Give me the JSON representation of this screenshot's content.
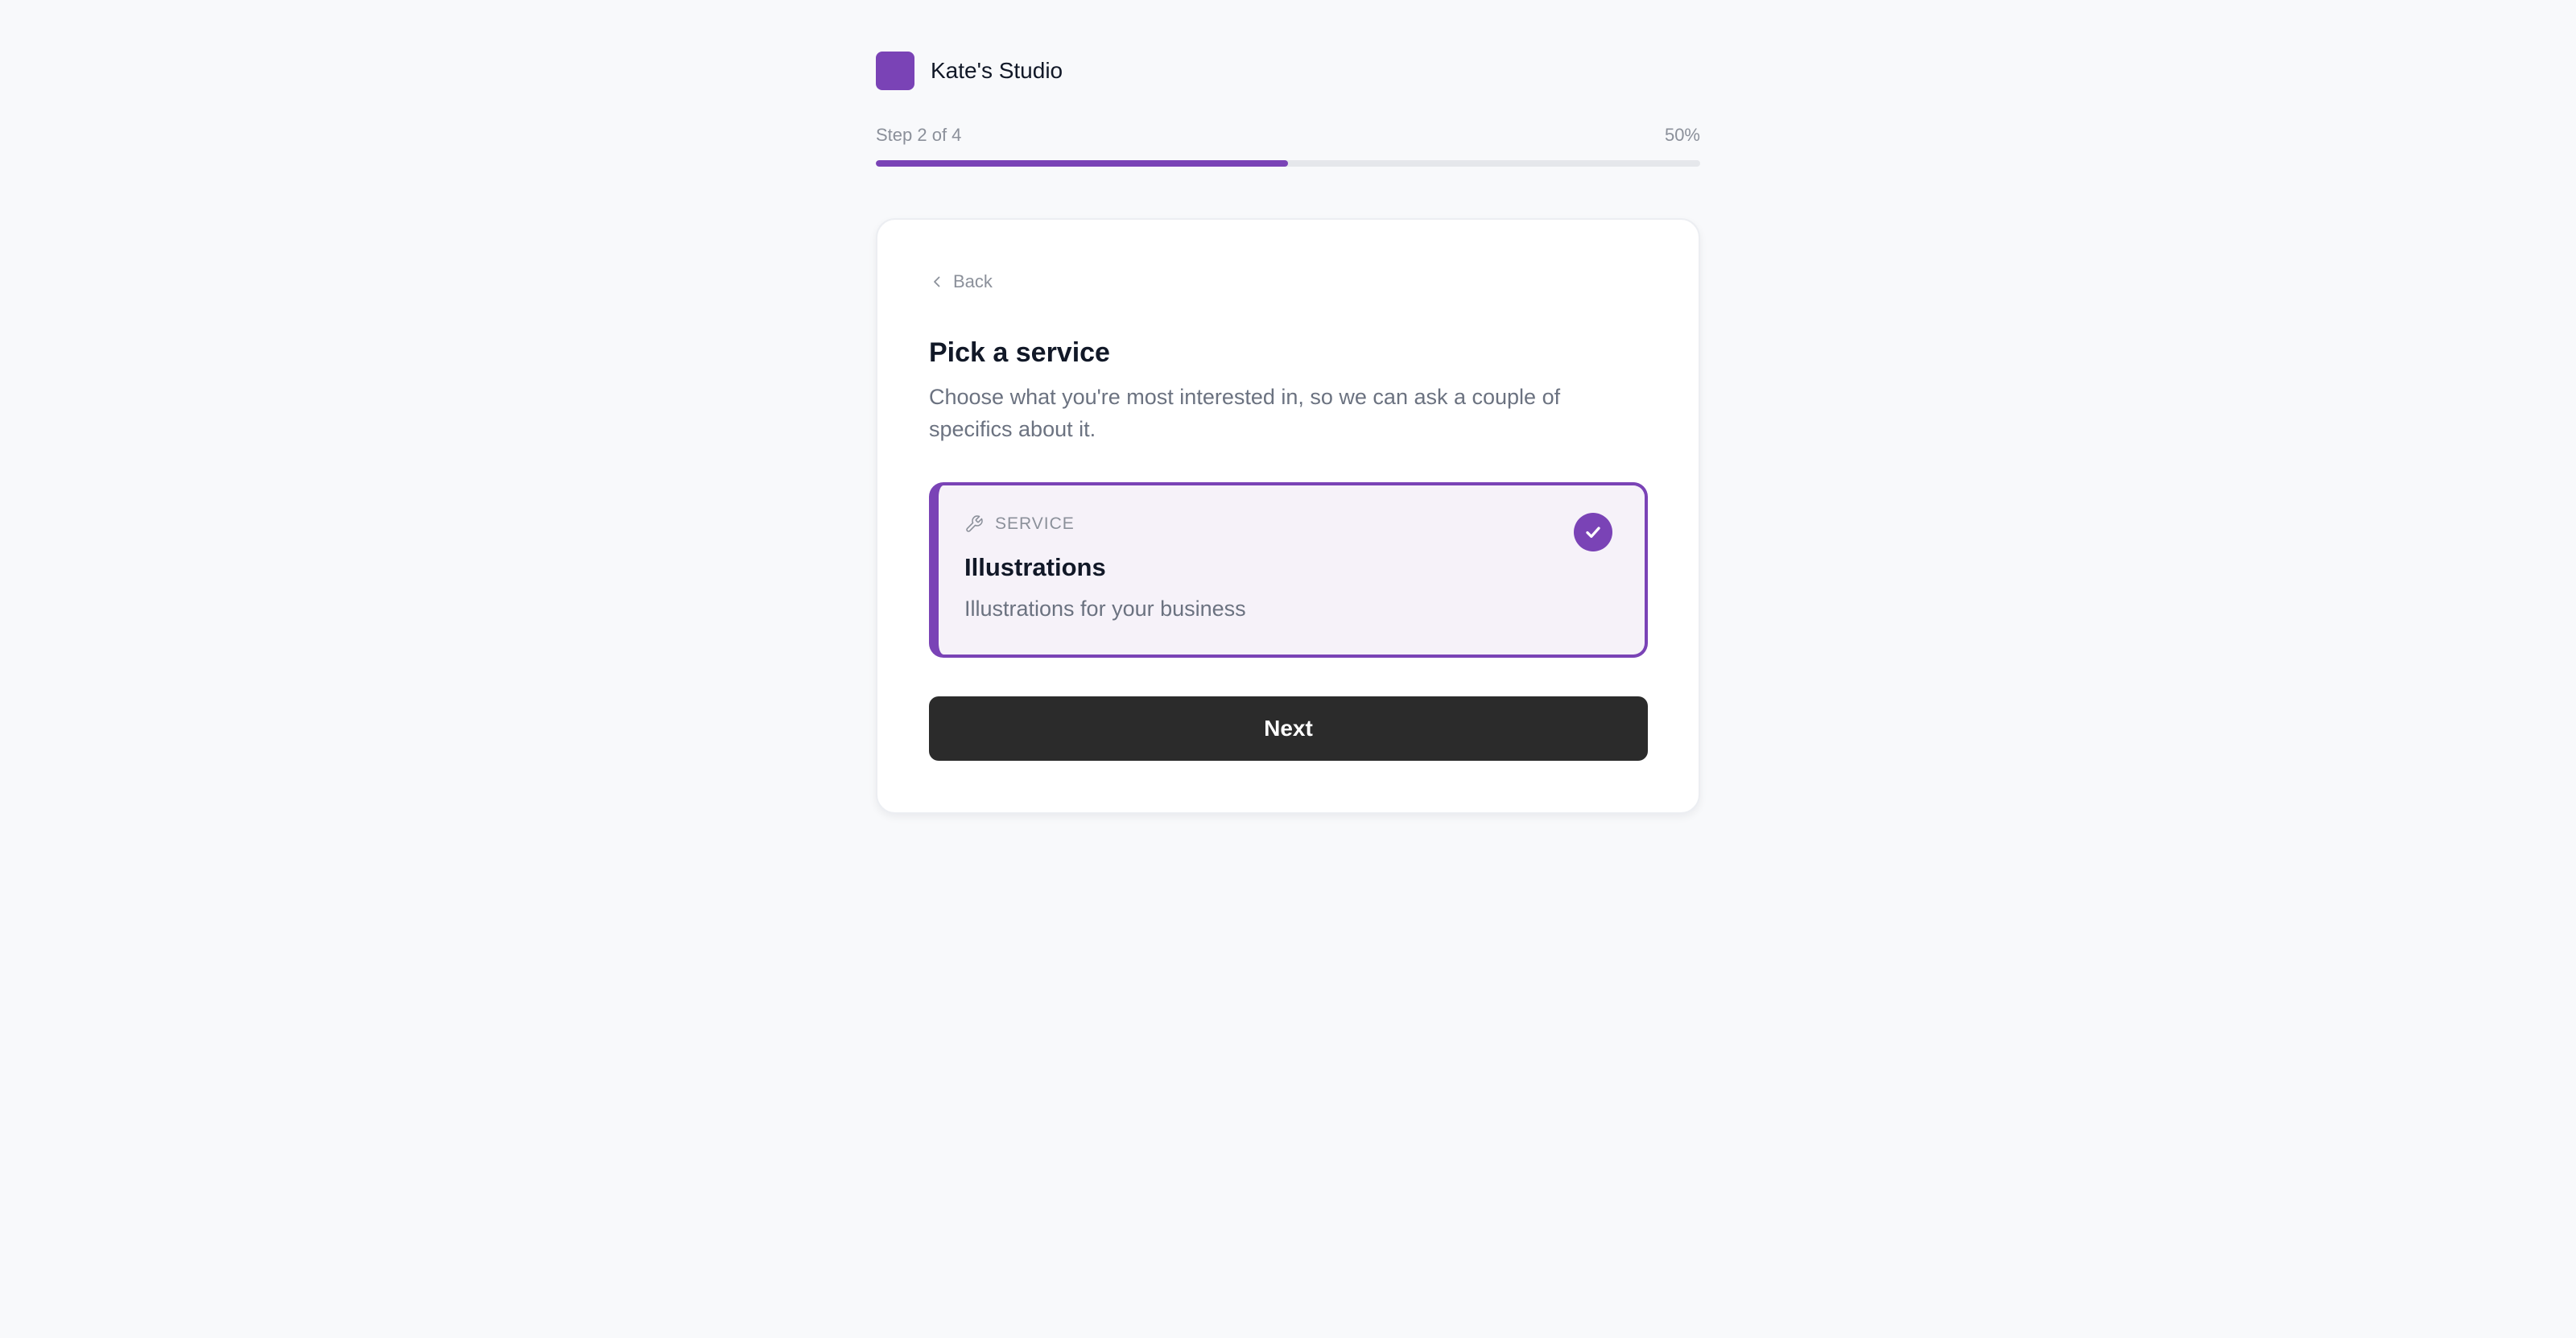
{
  "brand": {
    "name": "Kate's Studio",
    "color": "#7a43b6"
  },
  "progress": {
    "step_label": "Step 2 of 4",
    "percent_label": "50%",
    "fraction": 0.5
  },
  "card": {
    "back_label": "Back",
    "title": "Pick a service",
    "subtitle": "Choose what you're most interested in, so we can ask a couple of specifics about it.",
    "option": {
      "tag": "SERVICE",
      "title": "Illustrations",
      "description": "Illustrations for your business",
      "selected": true,
      "tag_icon": "wrench-icon",
      "selected_icon": "check-icon"
    },
    "next_label": "Next"
  },
  "colors": {
    "accent": "#7a43b6",
    "button": "#2b2b2b",
    "background": "#f8f9fb"
  }
}
